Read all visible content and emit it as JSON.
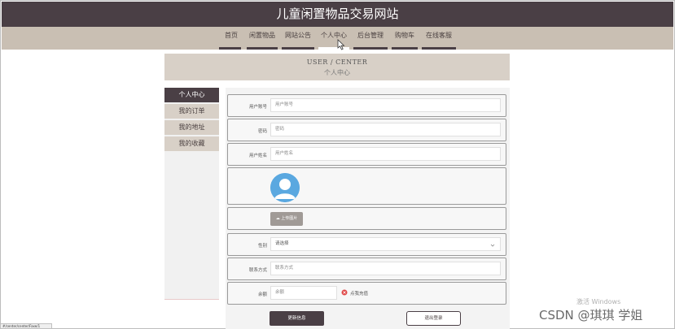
{
  "site_title": "儿童闲置物品交易网站",
  "nav": [
    {
      "label": "首页"
    },
    {
      "label": "闲置物品"
    },
    {
      "label": "网站公告"
    },
    {
      "label": "个人中心",
      "active": true
    },
    {
      "label": "后台管理"
    },
    {
      "label": "购物车"
    },
    {
      "label": "在线客服"
    }
  ],
  "banner": {
    "en": "USER / CENTER",
    "zh": "个人中心"
  },
  "sidebar": [
    {
      "label": "个人中心",
      "active": true
    },
    {
      "label": "我的订单"
    },
    {
      "label": "我的地址"
    },
    {
      "label": "我的收藏"
    }
  ],
  "form": {
    "account": {
      "label": "用户账号",
      "placeholder": "用户账号"
    },
    "password": {
      "label": "密码",
      "placeholder": "密码"
    },
    "name": {
      "label": "用户姓名",
      "placeholder": "用户姓名"
    },
    "upload_label": "上传图片",
    "gender": {
      "label": "性别",
      "value": "请选择"
    },
    "contact": {
      "label": "联系方式",
      "placeholder": "联系方式"
    },
    "balance": {
      "label": "余额",
      "placeholder": "余额",
      "recharge": "点我充值"
    }
  },
  "buttons": {
    "update": "更新信息",
    "logout": "退出登录"
  },
  "overlay": {
    "windows_watermark": "激活 Windows",
    "csdn_watermark": "CSDN @琪琪 学姐",
    "status_url": "#/center/center/Faxe/1"
  },
  "colors": {
    "header": "#4a3f45",
    "nav_bg": "#c9bfb3",
    "accent": "#d8d0c7",
    "recharge_icon": "#e04848"
  },
  "icons": [
    "cursor-icon",
    "avatar-icon",
    "upload-icon",
    "chevron-down-icon",
    "recharge-icon"
  ]
}
